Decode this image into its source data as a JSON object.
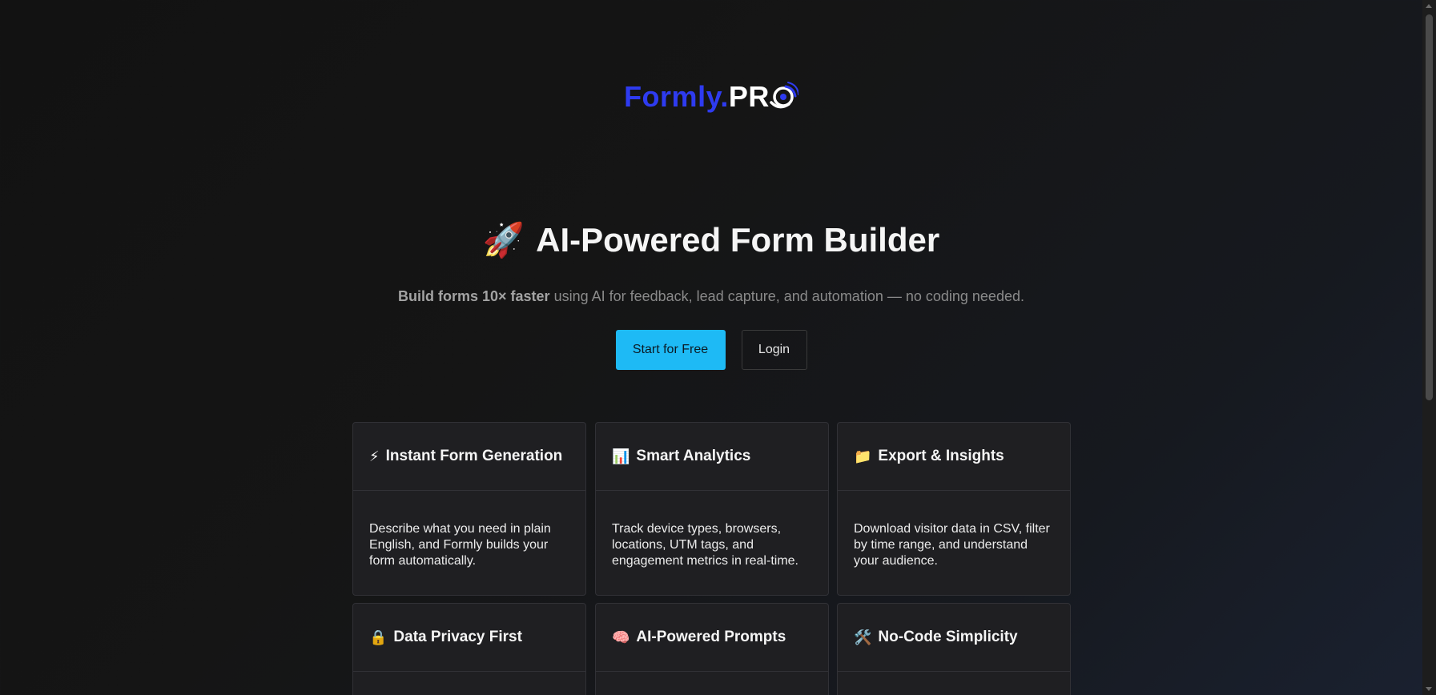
{
  "logo": {
    "part1": "Formly.",
    "part2": "PR",
    "colors": {
      "primary": "#2e3bf0",
      "secondary": "#ffffff"
    }
  },
  "hero": {
    "emoji": "🚀",
    "title": "AI-Powered Form Builder",
    "subtitle_bold": "Build forms 10× faster",
    "subtitle_rest": " using AI for feedback, lead capture, and automation — no coding needed."
  },
  "cta": {
    "primary_label": "Start for Free",
    "secondary_label": "Login",
    "primary_color": "#1ebaf5"
  },
  "features": [
    {
      "emoji": "⚡",
      "title": "Instant Form Generation",
      "body": "Describe what you need in plain English, and Formly builds your form automatically."
    },
    {
      "emoji": "📊",
      "title": "Smart Analytics",
      "body": "Track device types, browsers, locations, UTM tags, and engagement metrics in real-time."
    },
    {
      "emoji": "📁",
      "title": "Export & Insights",
      "body": "Download visitor data in CSV, filter by time range, and understand your audience."
    },
    {
      "emoji": "🔒",
      "title": "Data Privacy First",
      "body": ""
    },
    {
      "emoji": "🧠",
      "title": "AI-Powered Prompts",
      "body": ""
    },
    {
      "emoji": "🛠️",
      "title": "No-Code Simplicity",
      "body": ""
    }
  ]
}
